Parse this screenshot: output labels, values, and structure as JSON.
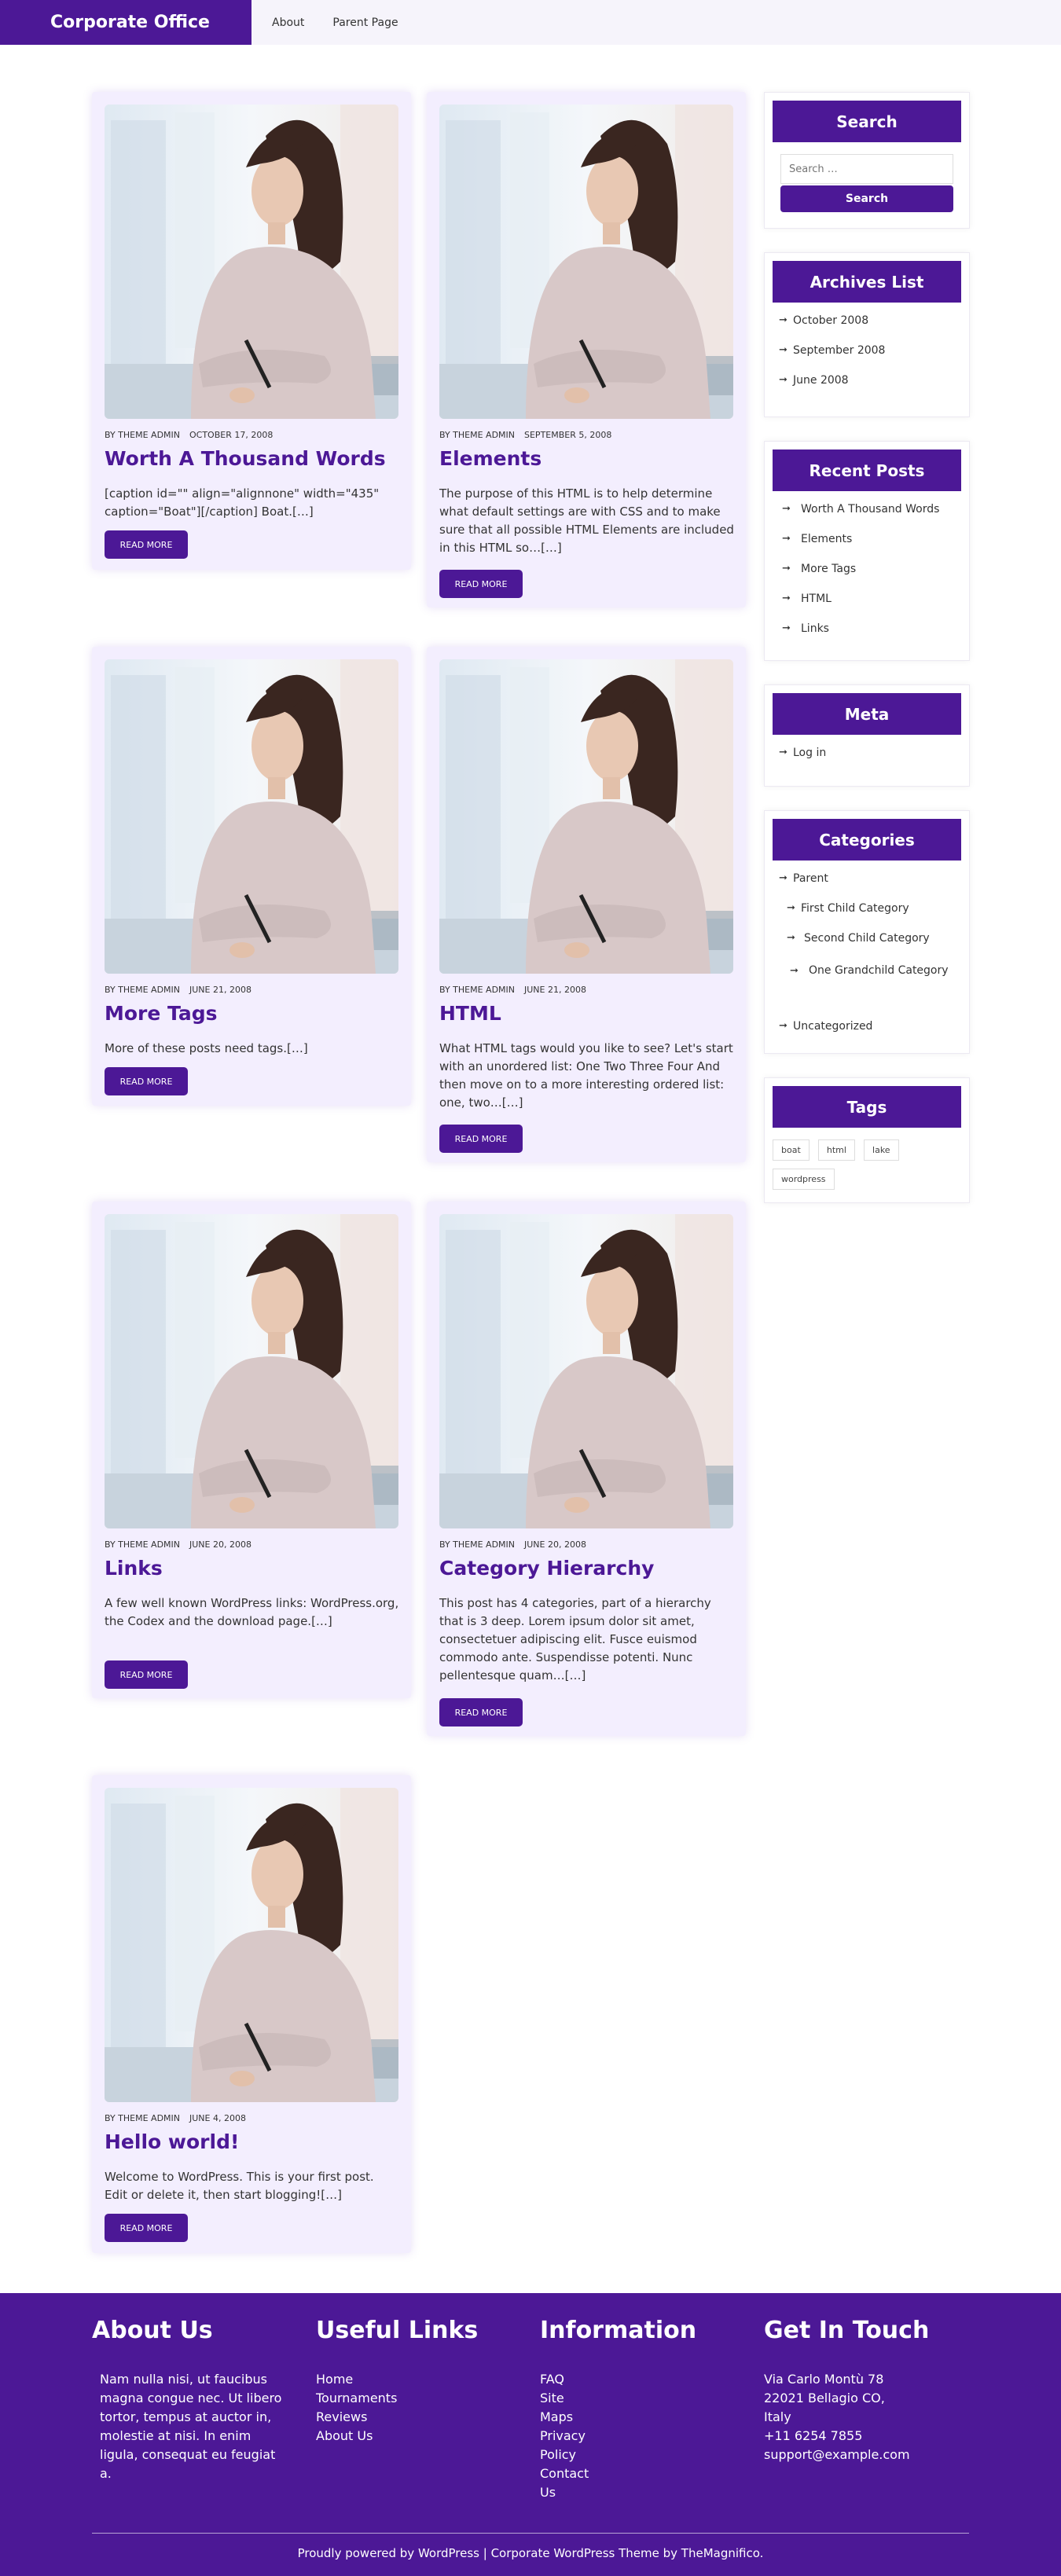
{
  "header": {
    "brand": "Corporate Office",
    "nav": [
      "About",
      "Parent Page"
    ]
  },
  "posts": [
    {
      "author": "BY THEME ADMIN",
      "date": "OCTOBER 17, 2008",
      "title": "Worth A Thousand Words",
      "excerpt": "[caption id=\"\" align=\"alignnone\" width=\"435\" caption=\"Boat\"][/caption] Boat.[…]",
      "button": "READ MORE"
    },
    {
      "author": "BY THEME ADMIN",
      "date": "SEPTEMBER 5, 2008",
      "title": "Elements",
      "excerpt": "The purpose of this HTML is to help determine what default settings are with CSS and to make sure that all possible HTML Elements are included in this HTML so…[…]",
      "button": "READ MORE"
    },
    {
      "author": "BY THEME ADMIN",
      "date": "JUNE 21, 2008",
      "title": "More Tags",
      "excerpt": "More of these posts need tags.[…]",
      "button": "READ MORE"
    },
    {
      "author": "BY THEME ADMIN",
      "date": "JUNE 21, 2008",
      "title": "HTML",
      "excerpt": "What HTML tags would you like to see? Let's start with an unordered list: One Two Three Four And then move on to a more interesting ordered list: one, two…[…]",
      "button": "READ MORE"
    },
    {
      "author": "BY THEME ADMIN",
      "date": "JUNE 20, 2008",
      "title": "Links",
      "excerpt": "A few well known WordPress links: WordPress.org, the Codex and the download page.[…]",
      "button": "READ MORE"
    },
    {
      "author": "BY THEME ADMIN",
      "date": "JUNE 20, 2008",
      "title": "Category Hierarchy",
      "excerpt": "This post has 4 categories, part of a hierarchy that is 3 deep. Lorem ipsum dolor sit amet, consectetuer adipiscing elit. Fusce euismod commodo ante. Suspendisse potenti. Nunc pellentesque quam…[…]",
      "button": "READ MORE"
    },
    {
      "author": "BY THEME ADMIN",
      "date": "JUNE 4, 2008",
      "title": "Hello world!",
      "excerpt": "Welcome to WordPress. This is your first post. Edit or delete it, then start blogging![…]",
      "button": "READ MORE"
    }
  ],
  "sidebar": {
    "search": {
      "title": "Search",
      "placeholder": "Search …",
      "button": "Search"
    },
    "archives": {
      "title": "Archives List",
      "items": [
        "October 2008",
        "September 2008",
        "June 2008"
      ]
    },
    "recent": {
      "title": "Recent Posts",
      "items": [
        "Worth A Thousand Words",
        "Elements",
        "More Tags",
        "HTML",
        "Links"
      ]
    },
    "meta": {
      "title": "Meta",
      "items": [
        "Log in"
      ]
    },
    "categories": {
      "title": "Categories",
      "items": [
        "Parent",
        "First Child Category",
        "Second Child Category",
        "One Grandchild Category",
        "Uncategorized"
      ]
    },
    "tags": {
      "title": "Tags",
      "items": [
        "boat",
        "html",
        "lake",
        "wordpress"
      ]
    }
  },
  "footer": {
    "about": {
      "title": "About Us",
      "text": "Nam nulla nisi, ut faucibus magna congue nec. Ut libero tortor, tempus at auctor in, molestie at nisi. In enim ligula, consequat eu feugiat a."
    },
    "useful": {
      "title": "Useful Links",
      "items": [
        "Home",
        "Tournaments",
        "Reviews",
        "About Us"
      ]
    },
    "info": {
      "title": "Information",
      "items": [
        "FAQ",
        "Site Maps",
        "Privacy Policy",
        "Contact Us"
      ]
    },
    "contact": {
      "title": "Get In Touch",
      "items": [
        "Via Carlo Montù 78",
        "22021 Bellagio CO, Italy",
        "+11 6254 7855",
        "support@example.com"
      ]
    },
    "copyright": "Proudly powered by WordPress | Corporate WordPress Theme by TheMagnifico."
  },
  "colors": {
    "brand": "#4c1896",
    "card_bg": "#f3eefe",
    "header_bg": "#f6f4fb"
  },
  "icons": [
    "arrow-right-icon",
    "post-image"
  ]
}
